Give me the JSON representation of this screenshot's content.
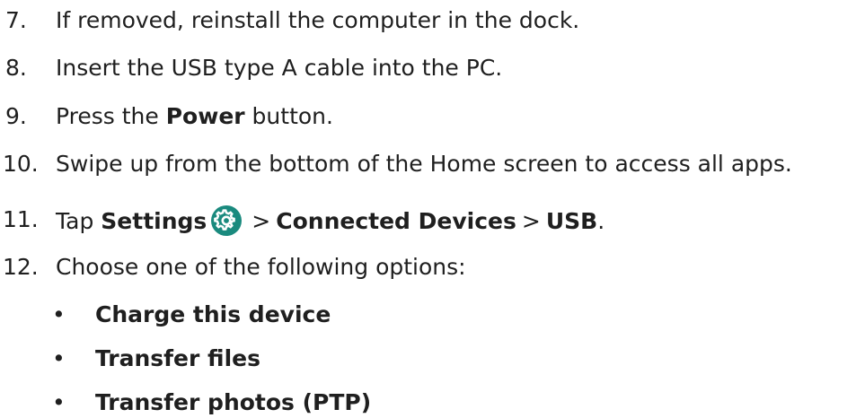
{
  "steps": [
    {
      "num": "7.",
      "text": "If removed, reinstall the computer in the dock."
    },
    {
      "num": "8.",
      "text": "Insert the USB type A cable into the PC."
    },
    {
      "num": "9.",
      "pre": "Press the ",
      "bold": "Power",
      "post": " button."
    },
    {
      "num": "10.",
      "text": "Swipe up from the bottom of the Home screen to access all apps."
    },
    {
      "num": "11.",
      "pre": "Tap ",
      "b1": "Settings",
      "sep1": ">",
      "b2": "Connected Devices",
      "sep2": ">",
      "b3": "USB",
      "post": "."
    },
    {
      "num": "12.",
      "text": "Choose one of the following options:"
    }
  ],
  "options": [
    {
      "bullet": "•",
      "label": "Charge this device"
    },
    {
      "bullet": "•",
      "label": "Transfer files"
    },
    {
      "bullet": "•",
      "label": "Transfer photos (PTP)"
    }
  ],
  "icons": {
    "settings": "gear-icon",
    "settings_color": "#1a8a7e"
  }
}
